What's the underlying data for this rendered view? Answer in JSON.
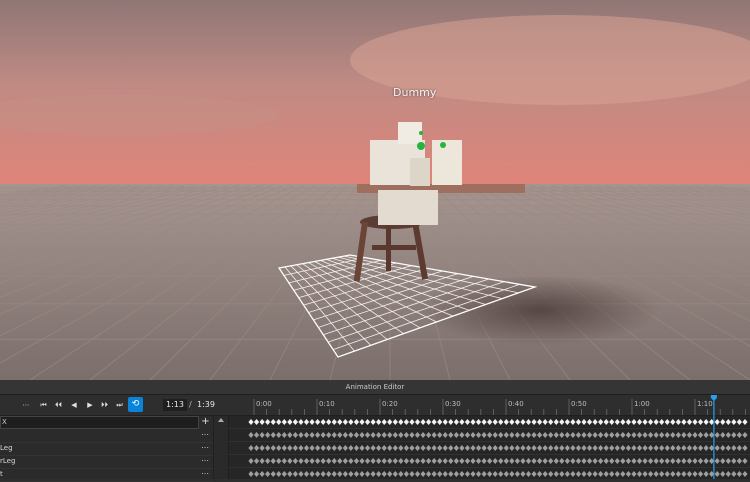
{
  "viewport": {
    "character_name": "Dummy",
    "colors": {
      "sky_top": "#a6857e",
      "sky_horizon": "#d9837a",
      "ground": "#8c7c79"
    }
  },
  "editor": {
    "title": "Animation Editor",
    "toolbar": {
      "more_label": "⋯",
      "buttons": [
        {
          "name": "first-frame-button",
          "icon": "skip-first-icon",
          "label": "⏮"
        },
        {
          "name": "prev-keyframe-button",
          "icon": "skip-prev-icon",
          "label": "⏴⏴"
        },
        {
          "name": "play-reverse-button",
          "icon": "play-reverse-icon",
          "label": "◀"
        },
        {
          "name": "play-button",
          "icon": "play-icon",
          "label": "▶"
        },
        {
          "name": "next-keyframe-button",
          "icon": "skip-next-icon",
          "label": "⏵⏵"
        },
        {
          "name": "last-frame-button",
          "icon": "skip-last-icon",
          "label": "⏭"
        }
      ],
      "loop_icon": "loop-icon",
      "loop_label": "⟲",
      "loop_color": "#0a84d8",
      "curve_label": "⟋",
      "time_current": "1:13",
      "time_separator": "/",
      "time_total": "1:39"
    },
    "tracks": {
      "search_prefix": "X",
      "add_label": "+",
      "rows": [
        {
          "name": "Leg",
          "more": "⋯"
        },
        {
          "name": "rLeg",
          "more": "⋯"
        },
        {
          "name": "t",
          "more": "⋯"
        }
      ],
      "first_more": "⋯"
    },
    "timeline": {
      "ticks": [
        "0:00",
        "0:10",
        "0:20",
        "0:30",
        "0:40",
        "0:50",
        "1:00",
        "1:10"
      ],
      "scrubber_position": "1:13",
      "keyframe_color": "#e6e6e6",
      "scrubber_color": "#2a9ef0"
    }
  }
}
